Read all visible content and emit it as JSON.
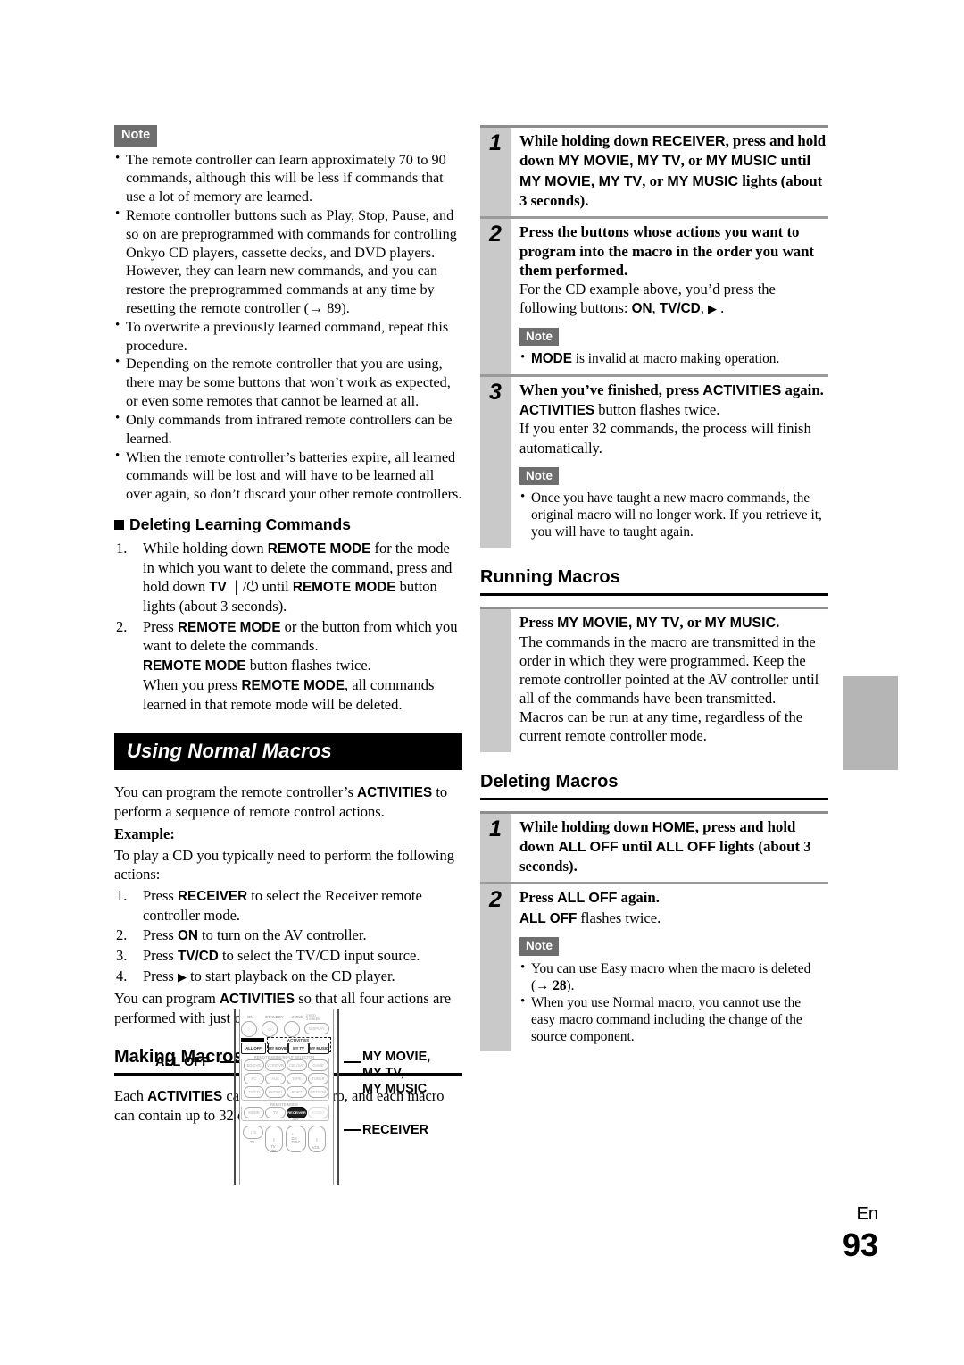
{
  "left_column": {
    "note_badge": "Note",
    "notes": [
      "The remote controller can learn approximately 70 to 90 commands, although this will be less if commands that use a lot of memory are learned.",
      "Remote controller buttons such as Play, Stop, Pause, and so on are preprogrammed with commands for controlling Onkyo CD players, cassette decks, and DVD players. However, they can learn new commands, and you can restore the preprogrammed commands at any time by resetting the remote controller (→ 89).",
      "To overwrite a previously learned command, repeat this procedure.",
      "Depending on the remote controller that you are using, there may be some buttons that won’t work as expected, or even some remotes that cannot be learned at all.",
      "Only commands from infrared remote controllers can be learned.",
      "When the remote controller’s batteries expire, all learned commands will be lost and will have to be learned all over again, so don’t discard your other remote controllers."
    ],
    "deleting_learning": {
      "heading": "Deleting Learning Commands",
      "steps": [
        {
          "num": "1.",
          "parts": [
            {
              "t": "While holding down ",
              "s": "plain"
            },
            {
              "t": "REMOTE MODE",
              "s": "sans-b"
            },
            {
              "t": " for the mode in which you want to delete the command, press and hold down ",
              "s": "plain"
            },
            {
              "t": "TV",
              "s": "sans-b"
            },
            {
              "t": " ❘/⏻ ",
              "s": "plain"
            },
            {
              "t": "until ",
              "s": "plain"
            },
            {
              "t": "REMOTE MODE",
              "s": "sans-b"
            },
            {
              "t": " button lights (about 3 seconds).",
              "s": "plain"
            }
          ]
        },
        {
          "num": "2.",
          "parts": [
            {
              "t": "Press ",
              "s": "plain"
            },
            {
              "t": "REMOTE MODE",
              "s": "sans-b"
            },
            {
              "t": " or the button from which you want to delete the commands.",
              "s": "plain"
            },
            {
              "t": "\n",
              "s": "br"
            },
            {
              "t": "REMOTE MODE",
              "s": "sans-b"
            },
            {
              "t": " button flashes twice.",
              "s": "plain"
            },
            {
              "t": "\n",
              "s": "br"
            },
            {
              "t": "When you press ",
              "s": "plain"
            },
            {
              "t": "REMOTE MODE",
              "s": "sans-b"
            },
            {
              "t": ", all commands learned in that remote mode will be deleted.",
              "s": "plain"
            }
          ]
        }
      ]
    },
    "banner": "Using Normal Macros",
    "intro_parts": [
      {
        "t": "You can program the remote controller’s ",
        "s": "plain"
      },
      {
        "t": "ACTIVITIES",
        "s": "sans-b"
      },
      {
        "t": " to perform a sequence of remote control actions.",
        "s": "plain"
      }
    ],
    "example_label": "Example:",
    "example_intro": "To play a CD you typically need to perform the following actions:",
    "example_steps": [
      {
        "num": "1.",
        "parts": [
          {
            "t": "Press ",
            "s": "plain"
          },
          {
            "t": "RECEIVER",
            "s": "sans-b"
          },
          {
            "t": " to select the Receiver remote controller mode.",
            "s": "plain"
          }
        ]
      },
      {
        "num": "2.",
        "parts": [
          {
            "t": "Press ",
            "s": "plain"
          },
          {
            "t": "ON",
            "s": "sans-b"
          },
          {
            "t": " to turn on the AV controller.",
            "s": "plain"
          }
        ]
      },
      {
        "num": "3.",
        "parts": [
          {
            "t": "Press ",
            "s": "plain"
          },
          {
            "t": "TV/CD",
            "s": "sans-b"
          },
          {
            "t": " to select the TV/CD input source.",
            "s": "plain"
          }
        ]
      },
      {
        "num": "4.",
        "parts": [
          {
            "t": "Press ",
            "s": "plain"
          },
          {
            "t": "▶",
            "s": "play"
          },
          {
            "t": " to start playback on the CD player.",
            "s": "plain"
          }
        ]
      }
    ],
    "example_outro_parts": [
      {
        "t": "You can program ",
        "s": "plain"
      },
      {
        "t": "ACTIVITIES",
        "s": "sans-b"
      },
      {
        "t": " so that all four actions are performed with just one button press.",
        "s": "plain"
      }
    ],
    "making_macros": {
      "heading": "Making Macros",
      "body_parts": [
        {
          "t": "Each ",
          "s": "plain"
        },
        {
          "t": "ACTIVITIES",
          "s": "sans-b"
        },
        {
          "t": " can store one macro, and each macro can contain up to 32 commands.",
          "s": "plain"
        }
      ]
    }
  },
  "right_column": {
    "making_steps": [
      {
        "num": "1",
        "lead_parts": [
          {
            "t": "While holding down ",
            "s": "plain"
          },
          {
            "t": "RECEIVER",
            "s": "sans-b"
          },
          {
            "t": ", press and hold down ",
            "s": "plain"
          },
          {
            "t": "MY MOVIE, MY TV",
            "s": "sans-b"
          },
          {
            "t": ", or ",
            "s": "plain"
          },
          {
            "t": "MY MUSIC",
            "s": "sans-b"
          },
          {
            "t": " until ",
            "s": "plain"
          },
          {
            "t": "MY MOVIE, MY TV",
            "s": "sans-b"
          },
          {
            "t": ", or ",
            "s": "plain"
          },
          {
            "t": "MY MUSIC",
            "s": "sans-b"
          },
          {
            "t": " lights (about 3 seconds).",
            "s": "plain"
          }
        ],
        "body_parts": [],
        "note_badge": null,
        "notes": []
      },
      {
        "num": "2",
        "lead_parts": [
          {
            "t": "Press the buttons whose actions you want to program into the macro in the order you want them performed.",
            "s": "plain"
          }
        ],
        "body_parts": [
          {
            "t": "For the CD example above, you’d press the following buttons: ",
            "s": "plain"
          },
          {
            "t": "ON",
            "s": "sans-b"
          },
          {
            "t": ", ",
            "s": "plain"
          },
          {
            "t": "TV/CD",
            "s": "sans-b"
          },
          {
            "t": ", ",
            "s": "plain"
          },
          {
            "t": "▶",
            "s": "play"
          },
          {
            "t": " .",
            "s": "plain"
          }
        ],
        "note_badge": "Note",
        "notes": [
          [
            {
              "t": "MODE",
              "s": "sans-b"
            },
            {
              "t": " is invalid at macro making operation.",
              "s": "plain"
            }
          ]
        ]
      },
      {
        "num": "3",
        "lead_parts": [
          {
            "t": "When you’ve finished, press ",
            "s": "plain"
          },
          {
            "t": "ACTIVITIES",
            "s": "sans-b"
          },
          {
            "t": " again.",
            "s": "plain"
          }
        ],
        "body_parts": [
          {
            "t": "ACTIVITIES",
            "s": "sans-b"
          },
          {
            "t": " button flashes twice.",
            "s": "plain"
          },
          {
            "t": "\n",
            "s": "br"
          },
          {
            "t": "If you enter 32 commands, the process will finish automatically.",
            "s": "plain"
          }
        ],
        "note_badge": "Note",
        "notes": [
          [
            {
              "t": "Once you have taught a new macro commands, the original macro will no longer work. If you retrieve it, you will have to taught again.",
              "s": "plain"
            }
          ]
        ]
      }
    ],
    "running_macros": {
      "heading": "Running Macros",
      "step": {
        "num": "",
        "lead_parts": [
          {
            "t": "Press ",
            "s": "plain"
          },
          {
            "t": "MY MOVIE, MY TV",
            "s": "sans-b"
          },
          {
            "t": ", or ",
            "s": "plain"
          },
          {
            "t": "MY MUSIC",
            "s": "sans-b"
          },
          {
            "t": ".",
            "s": "plain"
          }
        ],
        "body_parts": [
          {
            "t": "The commands in the macro are transmitted in the order in which they were programmed. Keep the remote controller pointed at the AV controller until all of the commands have been transmitted.",
            "s": "plain"
          },
          {
            "t": "\n",
            "s": "br"
          },
          {
            "t": "Macros can be run at any time, regardless of the current remote controller mode.",
            "s": "plain"
          }
        ]
      }
    },
    "deleting_macros": {
      "heading": "Deleting Macros",
      "steps": [
        {
          "num": "1",
          "lead_parts": [
            {
              "t": "While holding down ",
              "s": "plain"
            },
            {
              "t": "HOME",
              "s": "sans-b"
            },
            {
              "t": ", press and hold down ",
              "s": "plain"
            },
            {
              "t": "ALL OFF",
              "s": "sans-b"
            },
            {
              "t": " until ",
              "s": "plain"
            },
            {
              "t": "ALL OFF",
              "s": "sans-b"
            },
            {
              "t": " lights (about 3 seconds).",
              "s": "plain"
            }
          ],
          "body_parts": [],
          "note_badge": null,
          "notes": []
        },
        {
          "num": "2",
          "lead_parts": [
            {
              "t": "Press ",
              "s": "plain"
            },
            {
              "t": "ALL OFF",
              "s": "sans-b"
            },
            {
              "t": " again.",
              "s": "plain"
            }
          ],
          "body_parts": [
            {
              "t": "ALL OFF",
              "s": "sans-b"
            },
            {
              "t": " flashes twice.",
              "s": "plain"
            }
          ],
          "note_badge": "Note",
          "notes": [
            [
              {
                "t": "You can use Easy macro when the macro is deleted (→ ",
                "s": "plain"
              },
              {
                "t": "28",
                "s": "b"
              },
              {
                "t": ").",
                "s": "plain"
              }
            ],
            [
              {
                "t": "When you use Normal macro, you cannot use the easy macro command including the change of the source component.",
                "s": "plain"
              }
            ]
          ]
        }
      ]
    }
  },
  "remote_figure": {
    "callouts": {
      "all_off": "ALL OFF",
      "my_buttons": "MY MOVIE,\nMY TV,\nMY MUSIC",
      "receiver": "RECEIVER"
    },
    "top_row_labels": [
      "ON",
      "STANDBY",
      "ZONE",
      "2 RED\n3 GREEN"
    ],
    "top_row_keys": [
      "❘",
      "⏻",
      "",
      "DISPLAY"
    ],
    "activities_label": "ACTIVITIES",
    "activities_keys": [
      "MY MOVIE",
      "MY TV",
      "MY MUSIC"
    ],
    "all_off_key": "ALL OFF",
    "selector_label": "REMOTE MODE/INPUT SELECTOR",
    "selector_keys": [
      "BD/DVD",
      "VCR/DVR",
      "CBL/SAT",
      "GAME",
      "PC",
      "AUX",
      "TAPE",
      "TUNER",
      "TV/CD",
      "PHONO",
      "PORT",
      "NET/USB"
    ],
    "remote_mode_label": "REMOTE MODE",
    "remote_mode_keys": [
      "MODE",
      "TV",
      "RECEIVER",
      "ZONE2"
    ],
    "receiver_sub": "AMP",
    "bottom_keys": [
      "❘/⏻",
      "❙",
      "+\nCH\nDISC",
      "❙"
    ],
    "bottom_caps": [
      "TV",
      "TV\nVOL",
      "",
      "VOL"
    ]
  },
  "footer": {
    "lang": "En",
    "page": "93"
  }
}
